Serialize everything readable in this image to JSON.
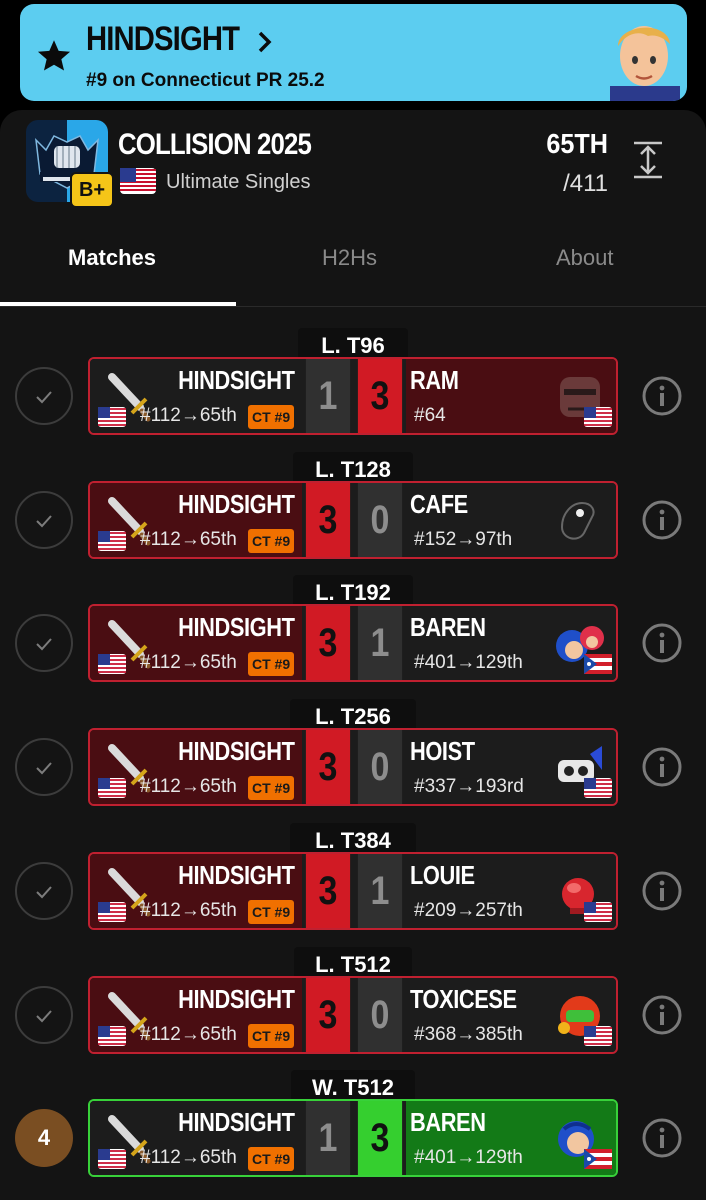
{
  "banner": {
    "name": "HINDSIGHT",
    "subtitle": "#9 on Connecticut PR 25.2"
  },
  "tournament": {
    "name": "COLLISION 2025",
    "grade": "B+",
    "type": "Ultimate Singles",
    "placement": "65TH",
    "entrants": "/411"
  },
  "tabs": [
    {
      "label": "Matches",
      "active": true
    },
    {
      "label": "H2Hs",
      "active": false
    },
    {
      "label": "About",
      "active": false
    }
  ],
  "matches": [
    {
      "round": "L. T96",
      "player": "HINDSIGHT",
      "player_rank": "#112→65th",
      "player_badge": "CT #9",
      "player_score": "1",
      "opponent_score": "3",
      "opponent": "RAM",
      "opponent_rank": "#64",
      "result": "loss",
      "opponent_flag": "us",
      "status": "done"
    },
    {
      "round": "L. T128",
      "player": "HINDSIGHT",
      "player_rank": "#112→65th",
      "player_badge": "CT #9",
      "player_score": "3",
      "opponent_score": "0",
      "opponent": "CAFE",
      "opponent_rank": "#152→97th",
      "result": "win",
      "opponent_flag": "",
      "status": "done"
    },
    {
      "round": "L. T192",
      "player": "HINDSIGHT",
      "player_rank": "#112→65th",
      "player_badge": "CT #9",
      "player_score": "3",
      "opponent_score": "1",
      "opponent": "BAREN",
      "opponent_rank": "#401→129th",
      "result": "win",
      "opponent_flag": "pr",
      "status": "done"
    },
    {
      "round": "L. T256",
      "player": "HINDSIGHT",
      "player_rank": "#112→65th",
      "player_badge": "CT #9",
      "player_score": "3",
      "opponent_score": "0",
      "opponent": "HOIST",
      "opponent_rank": "#337→193rd",
      "result": "win",
      "opponent_flag": "us",
      "status": "done"
    },
    {
      "round": "L. T384",
      "player": "HINDSIGHT",
      "player_rank": "#112→65th",
      "player_badge": "CT #9",
      "player_score": "3",
      "opponent_score": "1",
      "opponent": "LOUIE",
      "opponent_rank": "#209→257th",
      "result": "win",
      "opponent_flag": "us",
      "status": "done"
    },
    {
      "round": "L. T512",
      "player": "HINDSIGHT",
      "player_rank": "#112→65th",
      "player_badge": "CT #9",
      "player_score": "3",
      "opponent_score": "0",
      "opponent": "TOXICESE",
      "opponent_rank": "#368→385th",
      "result": "win",
      "opponent_flag": "us",
      "status": "done"
    },
    {
      "round": "W. T512",
      "player": "HINDSIGHT",
      "player_rank": "#112→65th",
      "player_badge": "CT #9",
      "player_score": "1",
      "opponent_score": "3",
      "opponent": "BAREN",
      "opponent_rank": "#401→129th",
      "result": "loss-w",
      "opponent_flag": "pr",
      "status": "4"
    }
  ],
  "colors": {
    "banner": "#5ccdf0",
    "loss_red": "#d11a24",
    "win_green": "#35cf2f",
    "badge_orange": "#f07000"
  }
}
